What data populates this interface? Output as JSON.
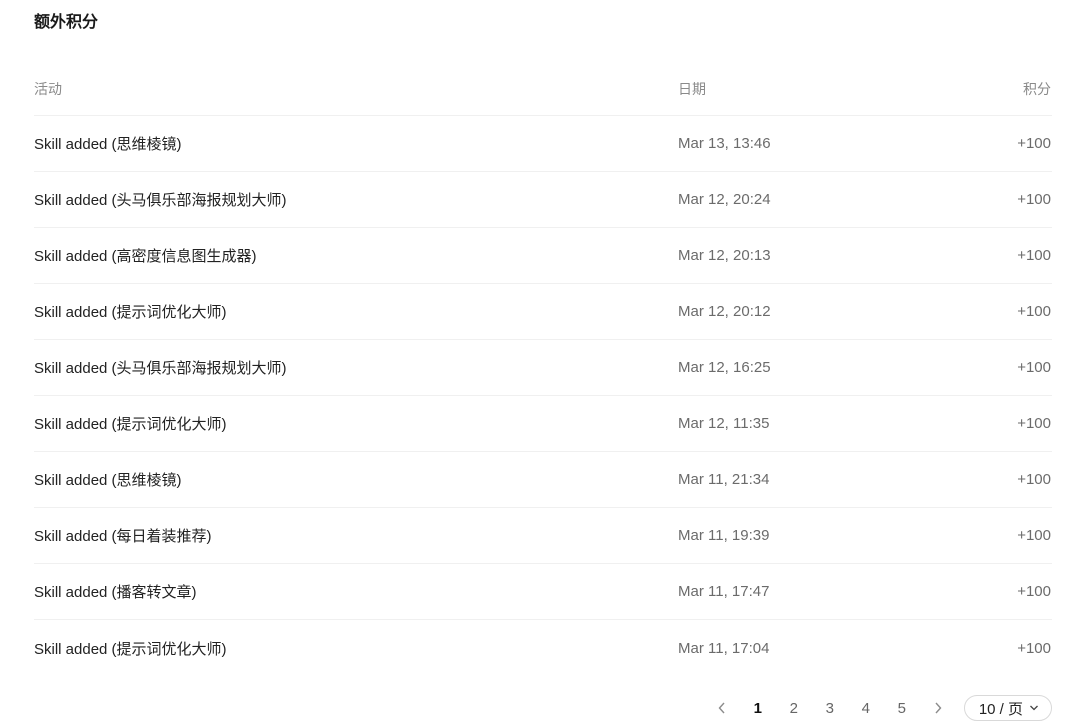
{
  "section": {
    "title": "额外积分"
  },
  "table": {
    "columns": {
      "activity": "活动",
      "date": "日期",
      "points": "积分"
    },
    "rows": [
      {
        "activity": "Skill added (思维棱镜)",
        "date": "Mar 13, 13:46",
        "points": "+100"
      },
      {
        "activity": "Skill added (头马俱乐部海报规划大师)",
        "date": "Mar 12, 20:24",
        "points": "+100"
      },
      {
        "activity": "Skill added (高密度信息图生成器)",
        "date": "Mar 12, 20:13",
        "points": "+100"
      },
      {
        "activity": "Skill added (提示词优化大师)",
        "date": "Mar 12, 20:12",
        "points": "+100"
      },
      {
        "activity": "Skill added (头马俱乐部海报规划大师)",
        "date": "Mar 12, 16:25",
        "points": "+100"
      },
      {
        "activity": "Skill added (提示词优化大师)",
        "date": "Mar 12, 11:35",
        "points": "+100"
      },
      {
        "activity": "Skill added (思维棱镜)",
        "date": "Mar 11, 21:34",
        "points": "+100"
      },
      {
        "activity": "Skill added (每日着装推荐)",
        "date": "Mar 11, 19:39",
        "points": "+100"
      },
      {
        "activity": "Skill added (播客转文章)",
        "date": "Mar 11, 17:47",
        "points": "+100"
      },
      {
        "activity": "Skill added (提示词优化大师)",
        "date": "Mar 11, 17:04",
        "points": "+100"
      }
    ]
  },
  "pagination": {
    "prev_icon": "chevron-left-icon",
    "next_icon": "chevron-right-icon",
    "pages": [
      "1",
      "2",
      "3",
      "4",
      "5"
    ],
    "current_page": "1",
    "page_size_label": "10 / 页",
    "page_size_icon": "chevron-down-icon"
  }
}
